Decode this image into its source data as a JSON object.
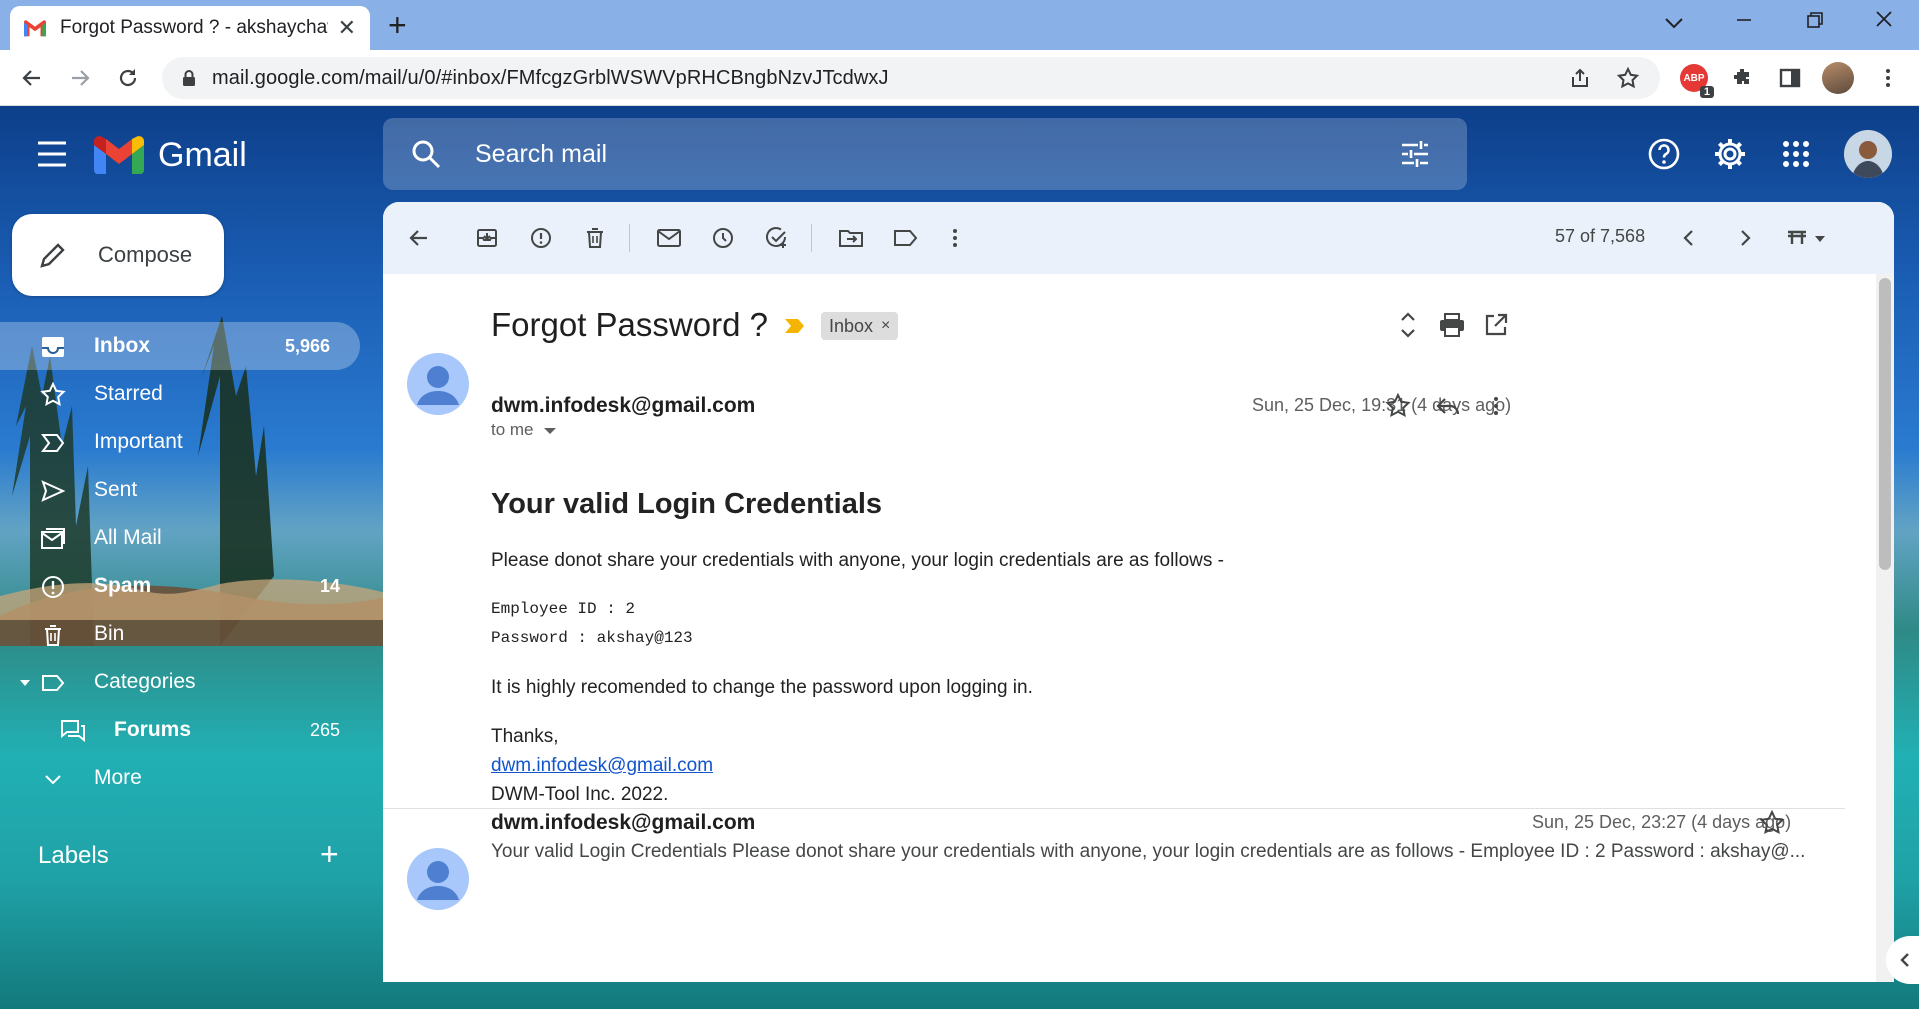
{
  "browser": {
    "tab_title": "Forgot Password ? - akshaychava",
    "url": "mail.google.com/mail/u/0/#inbox/FMfcgzGrblWSWVpRHCBngbNzvJTcdwxJ",
    "extension_badge": "ABP",
    "extension_count": "1"
  },
  "gmail": {
    "product_name": "Gmail",
    "search_placeholder": "Search mail",
    "compose_label": "Compose",
    "nav": [
      {
        "label": "Inbox",
        "count": "5,966",
        "icon": "inbox-icon",
        "active": true
      },
      {
        "label": "Starred",
        "count": "",
        "icon": "star-icon"
      },
      {
        "label": "Important",
        "count": "",
        "icon": "important-icon"
      },
      {
        "label": "Sent",
        "count": "",
        "icon": "send-icon"
      },
      {
        "label": "All Mail",
        "count": "",
        "icon": "all-mail-icon"
      },
      {
        "label": "Spam",
        "count": "14",
        "icon": "spam-icon"
      },
      {
        "label": "Bin",
        "count": "",
        "icon": "trash-icon"
      },
      {
        "label": "Categories",
        "count": "",
        "icon": "label-icon"
      },
      {
        "label": "Forums",
        "count": "265",
        "icon": "forum-icon"
      },
      {
        "label": "More",
        "count": "",
        "icon": "chevron-down-icon"
      }
    ],
    "labels_heading": "Labels"
  },
  "thread": {
    "position": "57 of 7,568",
    "subject": "Forgot Password ?",
    "label_chip": "Inbox",
    "label_chip_close": "×",
    "message1": {
      "sender": "dwm.infodesk@gmail.com",
      "recipient": "to me",
      "date": "Sun, 25 Dec, 19:31 (4 days ago)",
      "heading": "Your valid Login Credentials",
      "intro": "Please donot share your credentials with anyone, your login credentials are as follows -",
      "employee_line": "Employee ID : 2",
      "password_line": "Password : akshay@123",
      "advice": "It is highly recomended to change the password upon logging in.",
      "signoff": "Thanks,",
      "signature_email": "dwm.infodesk@gmail.com",
      "company": "DWM-Tool Inc. 2022."
    },
    "message2": {
      "sender": "dwm.infodesk@gmail.com",
      "date": "Sun, 25 Dec, 23:27 (4 days ago)",
      "snippet": "Your valid Login Credentials Please donot share your credentials with anyone, your login credentials are as follows - Employee ID : 2 Password : akshay@..."
    }
  },
  "colors": {
    "accent": "#0b57d0",
    "action_bar": "#eaf1fb",
    "chip_bg": "#dddddd",
    "importance_marker": "#f4b400"
  }
}
